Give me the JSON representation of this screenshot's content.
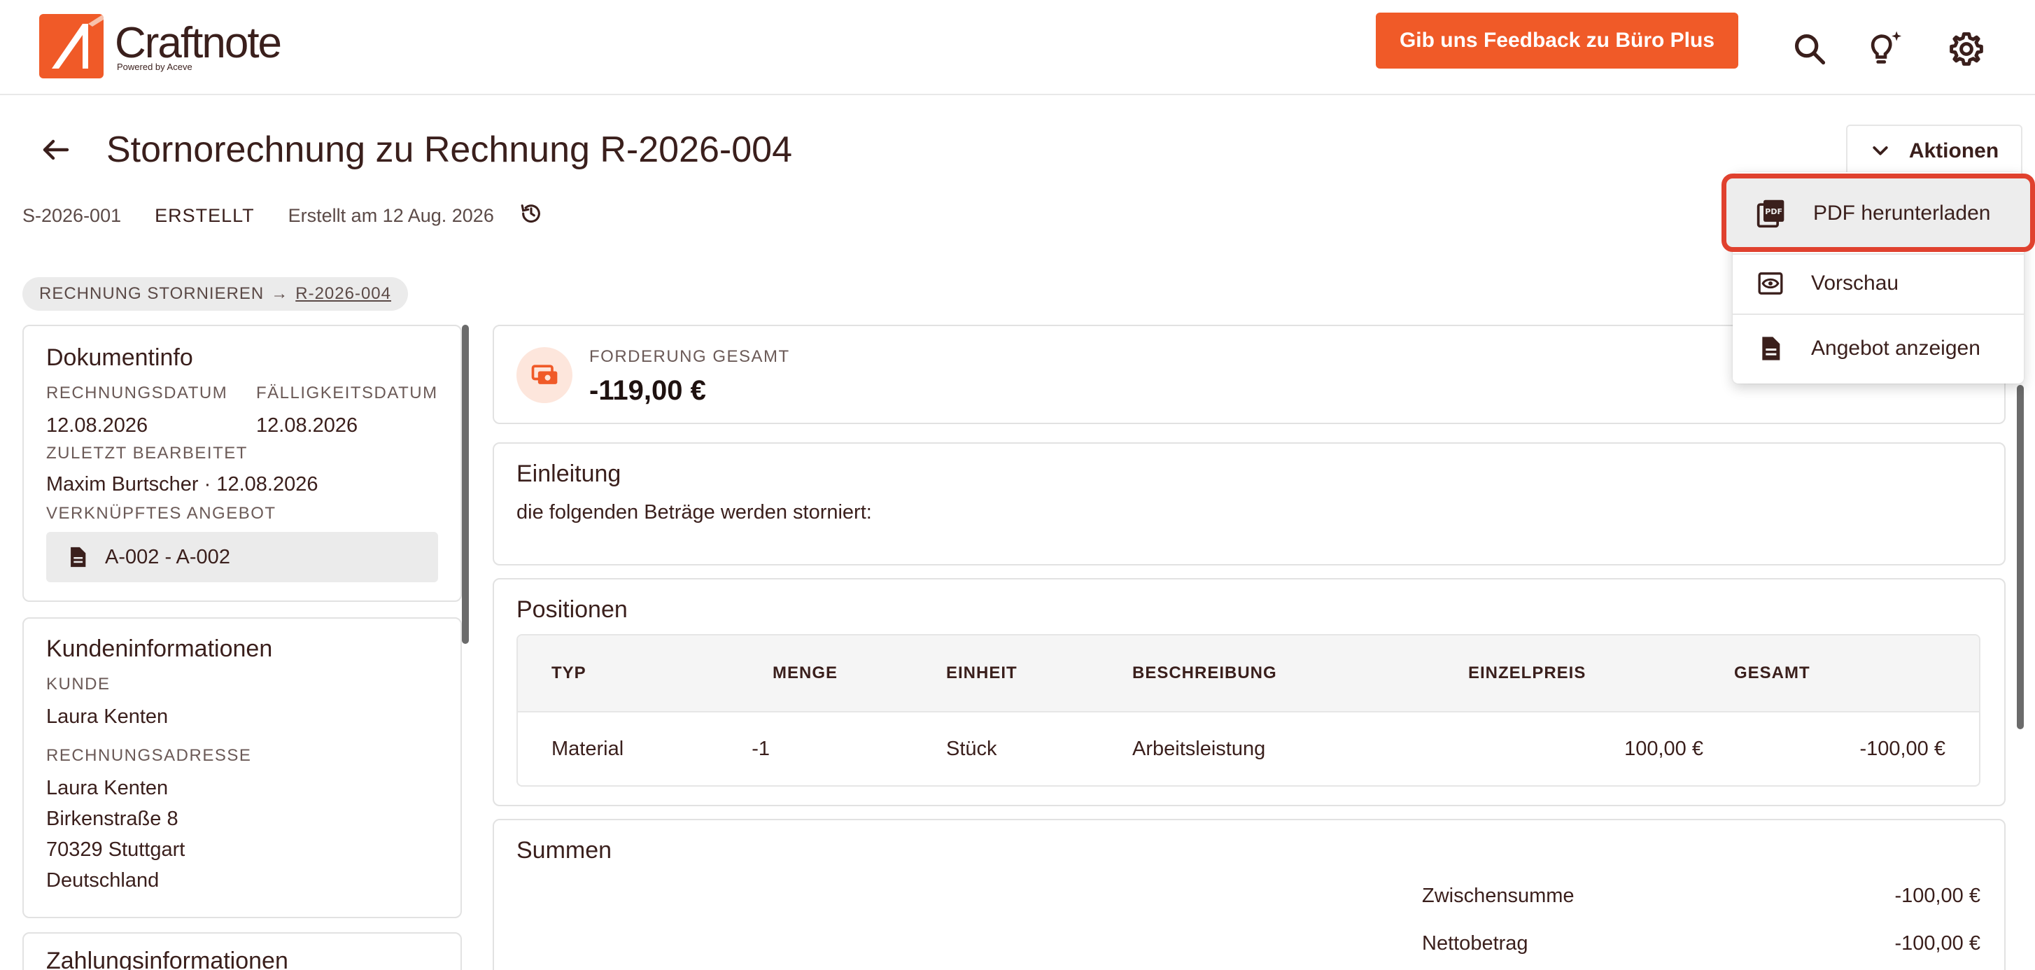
{
  "brand": {
    "name": "Craftnote",
    "tagline": "Powered by Aceve",
    "accent_color": "#f05a28"
  },
  "topbar": {
    "feedback_label": "Gib uns Feedback zu Büro Plus",
    "icons": [
      "search-icon",
      "lightbulb-sparkle-icon",
      "gear-icon"
    ]
  },
  "header": {
    "title": "Stornorechnung zu Rechnung R-2026-004",
    "number": "S-2026-001",
    "status": "ERSTELLT",
    "created": "Erstellt am 12 Aug. 2026",
    "actions_label": "Aktionen"
  },
  "breadcrumb_chip": {
    "label": "RECHNUNG STORNIEREN",
    "arrow": "→",
    "link": "R-2026-004"
  },
  "dropdown": {
    "items": [
      {
        "label": "PDF herunterladen",
        "icon": "pdf-icon"
      },
      {
        "label": "Vorschau",
        "icon": "eye-icon"
      },
      {
        "label": "Angebot anzeigen",
        "icon": "document-icon"
      }
    ]
  },
  "document_info": {
    "title": "Dokumentinfo",
    "invoice_date_label": "RECHNUNGSDATUM",
    "invoice_date": "12.08.2026",
    "due_date_label": "FÄLLIGKEITSDATUM",
    "due_date": "12.08.2026",
    "last_edited_label": "ZULETZT BEARBEITET",
    "last_edited": "Maxim Burtscher · 12.08.2026",
    "linked_offer_label": "VERKNÜPFTES ANGEBOT",
    "linked_offer": "A-002 - A-002"
  },
  "customer_info": {
    "title": "Kundeninformationen",
    "customer_label": "KUNDE",
    "customer": "Laura Kenten",
    "address_label": "RECHNUNGSADRESSE",
    "address_lines": [
      "Laura Kenten",
      "Birkenstraße 8",
      "70329 Stuttgart",
      "Deutschland"
    ]
  },
  "payment_info": {
    "title": "Zahlungsinformationen"
  },
  "claim": {
    "label": "FORDERUNG GESAMT",
    "amount": "-119,00 €"
  },
  "intro": {
    "title": "Einleitung",
    "text": "die folgenden Beträge werden storniert:"
  },
  "positions": {
    "title": "Positionen",
    "columns": [
      "TYP",
      "MENGE",
      "EINHEIT",
      "BESCHREIBUNG",
      "EINZELPREIS",
      "GESAMT"
    ],
    "rows": [
      {
        "typ": "Material",
        "menge": "-1",
        "einheit": "Stück",
        "beschreibung": "Arbeitsleistung",
        "einzelpreis": "100,00 €",
        "gesamt": "-100,00 €"
      }
    ]
  },
  "sums": {
    "title": "Summen",
    "subtotal_label": "Zwischensumme",
    "subtotal": "-100,00 €",
    "net_label": "Nettobetrag",
    "net": "-100,00 €"
  }
}
